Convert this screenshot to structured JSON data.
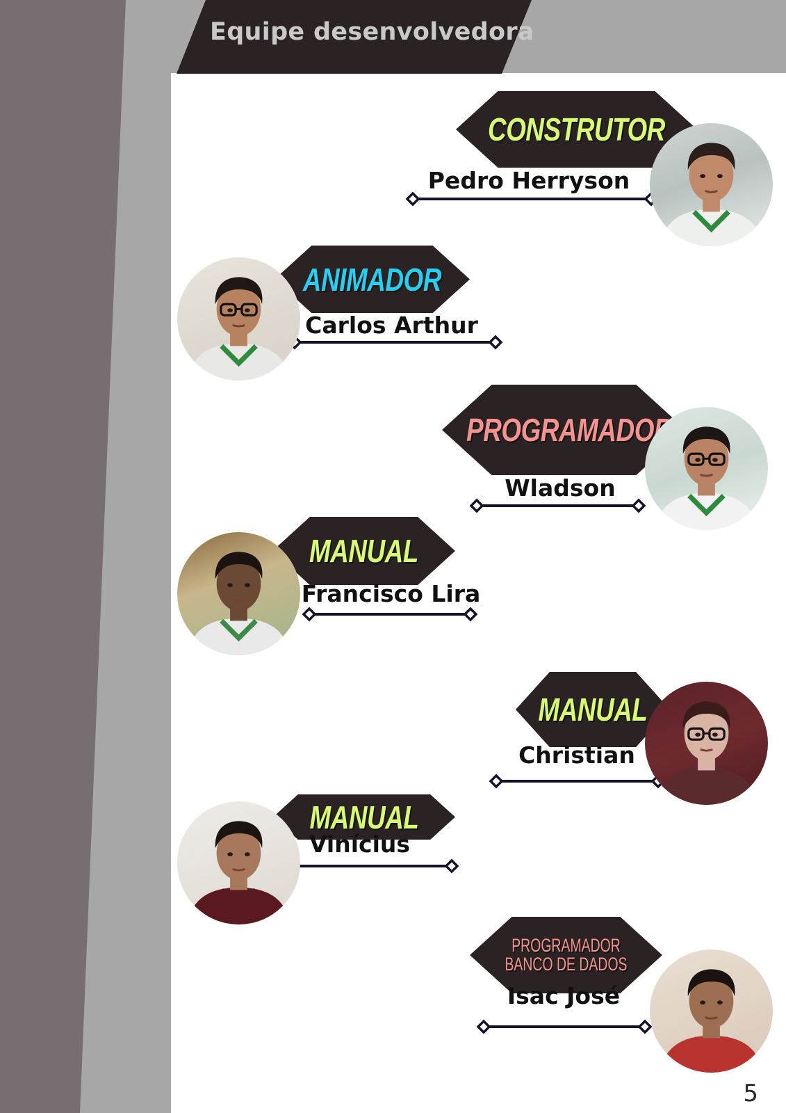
{
  "header": {
    "title": "Equipe desenvolvedora"
  },
  "colors": {
    "background_dark": "#766e70",
    "background_gray": "#a7a7a7",
    "banner": "#2a2223",
    "role_green": "#d7fb76",
    "role_cyan": "#29cdf0",
    "role_pink": "#f49390"
  },
  "team": [
    {
      "role": "CONSTRUTOR",
      "name": "Pedro Herryson",
      "role_color": "#d7fb76",
      "photo": "portrait-pedro"
    },
    {
      "role": "ANIMADOR",
      "name": "Carlos Arthur",
      "role_color": "#29cdf0",
      "photo": "portrait-carlos"
    },
    {
      "role": "PROGRAMADOR",
      "name": "Wladson",
      "role_color": "#f49390",
      "photo": "portrait-wladson"
    },
    {
      "role": "MANUAL",
      "name": "Francisco Lira",
      "role_color": "#d7fb76",
      "photo": "portrait-francisco"
    },
    {
      "role": "MANUAL",
      "name": "Christian",
      "role_color": "#d7fb76",
      "photo": "portrait-christian"
    },
    {
      "role": "MANUAL",
      "name": "Vinícius",
      "role_color": "#d7fb76",
      "photo": "portrait-vinicius"
    },
    {
      "role": "PROGRAMADOR\nBANCO DE DADOS",
      "name": "Isac José",
      "role_color": "#f49390",
      "photo": "portrait-isac"
    }
  ],
  "page_number": "5"
}
